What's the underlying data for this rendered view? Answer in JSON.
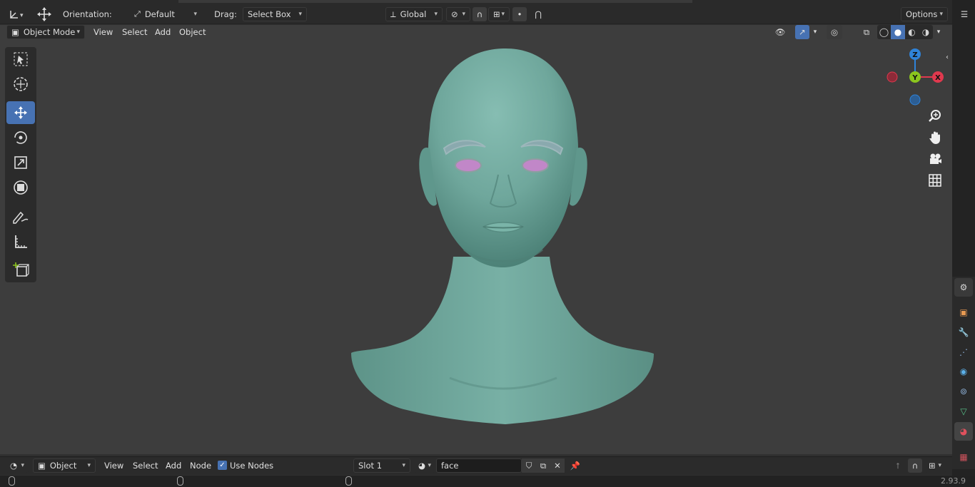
{
  "header": {
    "orientation_label": "Orientation:",
    "orientation_value": "Default",
    "drag_label": "Drag:",
    "drag_value": "Select Box",
    "transform_space": "Global",
    "options_label": "Options"
  },
  "viewport_header": {
    "mode": "Object Mode",
    "menus": [
      "View",
      "Select",
      "Add",
      "Object"
    ]
  },
  "gizmo": {
    "z": "Z",
    "y": "Y",
    "x": "X"
  },
  "node_header": {
    "object_type": "Object",
    "menus": [
      "View",
      "Select",
      "Add",
      "Node"
    ],
    "use_nodes_label": "Use Nodes",
    "use_nodes_checked": true,
    "slot": "Slot 1",
    "material_name": "face"
  },
  "status_bar": {
    "version": "2.93.9"
  },
  "icons": {
    "toolbar": [
      "select-box-icon",
      "cursor-icon",
      "move-icon",
      "rotate-icon",
      "scale-icon",
      "transform-icon",
      "annotate-icon",
      "measure-icon",
      "add-cube-icon"
    ],
    "navigation": [
      "zoom-icon",
      "hand-pan-icon",
      "camera-icon",
      "grid-ortho-icon"
    ],
    "properties_tabs": [
      "tool-icon",
      "object-icon",
      "wrench-icon",
      "particles-icon",
      "physics-icon",
      "constraints-icon",
      "data-icon",
      "material-icon",
      "texture-icon"
    ]
  },
  "colors": {
    "active_tool": "#4772b3",
    "mesh": "#6fa79c",
    "eyes": "#c187c8",
    "axis_x": "#e0394e",
    "axis_y": "#8bc51e",
    "axis_z": "#2f83d9"
  }
}
